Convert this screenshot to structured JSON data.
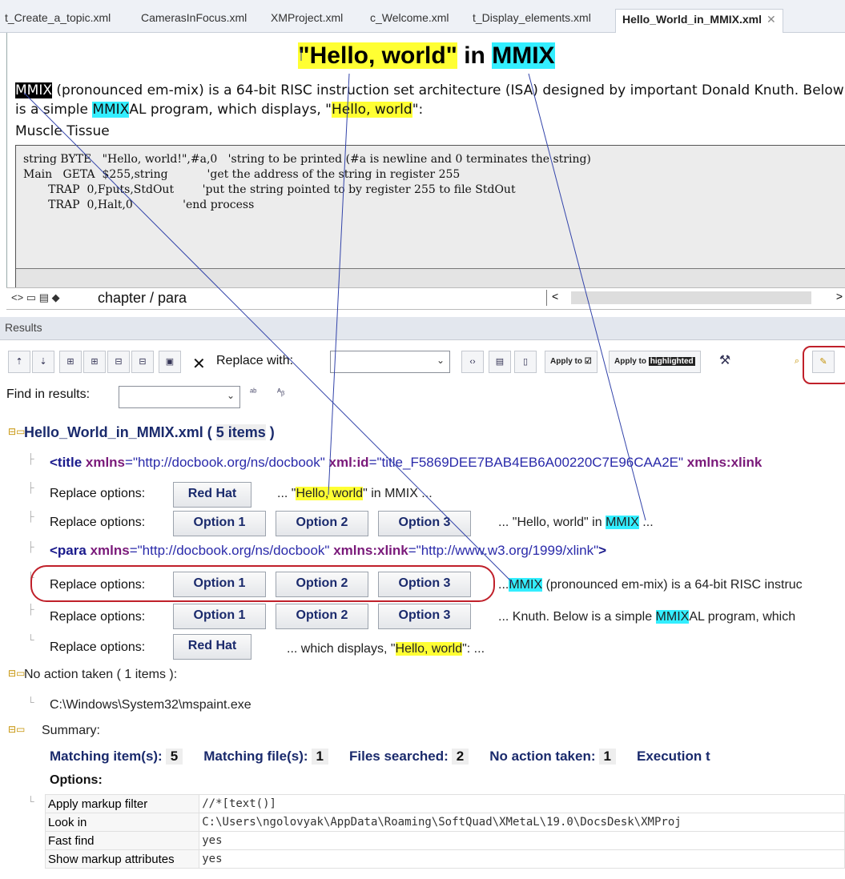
{
  "tabs": [
    {
      "label": "t_Create_a_topic.xml"
    },
    {
      "label": "CamerasInFocus.xml"
    },
    {
      "label": "XMProject.xml"
    },
    {
      "label": "c_Welcome.xml"
    },
    {
      "label": "t_Display_elements.xml"
    },
    {
      "label": "Hello_World_in_MMIX.xml",
      "close": "✕"
    }
  ],
  "document": {
    "title_part1": "\"Hello, world\"",
    "title_part2": " in ",
    "title_part3": "MMIX",
    "para_mmix": "MMIX",
    "para_text1": " (pronounced em-mix) is a 64-bit RISC instruction set architecture (ISA) designed by important Donald Knuth. Below is a simple ",
    "para_mmixal_hl": "MMIX",
    "para_text2": "AL program, which displays, \"",
    "para_hw": "Hello, world",
    "para_text3": "\":",
    "muscle": "Muscle Tissue",
    "code": "string BYTE   \"Hello, world!\",#a,0   'string to be printed (#a is newline and 0 terminates the string)\nMain   GETA  $255,string           'get the address of the string in register 255\n       TRAP  0,Fputs,StdOut        'put the string pointed to by register 255 to file StdOut\n       TRAP  0,Halt,0              'end process"
  },
  "statusbar": {
    "icons": "<> ▭ ▤ ◆",
    "path": "chapter / para",
    "scroll_left": "<",
    "scroll_right": ">"
  },
  "results": {
    "header": "Results",
    "replace_with_label": "Replace with:",
    "find_in_results_label": "Find in results:",
    "apply_to": "Apply to ☑",
    "apply_to_highlighted_prefix": "Apply to ",
    "apply_to_highlighted_word": "highlighted",
    "close_x": "✕"
  },
  "tree": {
    "file": "Hello_World_in_MMIX.xml ( ",
    "file_count": "5 items",
    "file_end": " )",
    "title_tag": "<title",
    "title_attr1": " xmlns",
    "title_val1": "=\"http://docbook.org/ns/docbook\"",
    "title_attr2": " xml:id",
    "title_val2": "=\"title_F5869DEE7BAB4EB6A00220C7E96CAA2E\"",
    "title_attr3": " xmlns:xlink",
    "para_tag": "<para",
    "para_attr1": " xmlns",
    "para_val1": "=\"http://docbook.org/ns/docbook\"",
    "para_attr2": " xmlns:xlink",
    "para_val2": "=\"http://www.w3.org/1999/xlink\"",
    "para_end": ">",
    "replace_label": "Replace options:",
    "red_hat": "Red Hat",
    "option1": "Option 1",
    "option2": "Option 2",
    "option3": "Option 3",
    "snip1_a": "... \"",
    "snip1_hl": "Hello, world",
    "snip1_b": "\" in MMIX ...",
    "snip2_a": "... \"Hello, world\" in ",
    "snip2_hl": "MMIX",
    "snip2_b": " ...",
    "snip3_a": "...",
    "snip3_hl": "MMIX",
    "snip3_b": " (pronounced em-mix) is a 64-bit RISC instruc",
    "snip4_a": "... Knuth. Below is a simple ",
    "snip4_hl": "MMIX",
    "snip4_b": "AL program, which",
    "snip5_a": "... which displays, \"",
    "snip5_hl": "Hello, world",
    "snip5_b": "\": ...",
    "no_action": "No action taken ( 1 items ):",
    "no_action_path": "C:\\Windows\\System32\\mspaint.exe",
    "summary": "Summary:",
    "matching_items_label": "Matching item(s):",
    "matching_items": "5",
    "matching_files_label": "Matching file(s):",
    "matching_files": "1",
    "files_searched_label": "Files searched:",
    "files_searched": "2",
    "no_action_taken_label": "No action taken:",
    "no_action_taken": "1",
    "execution_label": "Execution t",
    "options_label": "Options:",
    "options": [
      {
        "k": "Apply markup filter",
        "v": "//*[text()]"
      },
      {
        "k": "Look in",
        "v": "C:\\Users\\ngolovyak\\AppData\\Roaming\\SoftQuad\\XMetaL\\19.0\\DocsDesk\\XMProj"
      },
      {
        "k": "Fast find",
        "v": "yes"
      },
      {
        "k": "Show markup attributes",
        "v": "yes"
      }
    ]
  }
}
